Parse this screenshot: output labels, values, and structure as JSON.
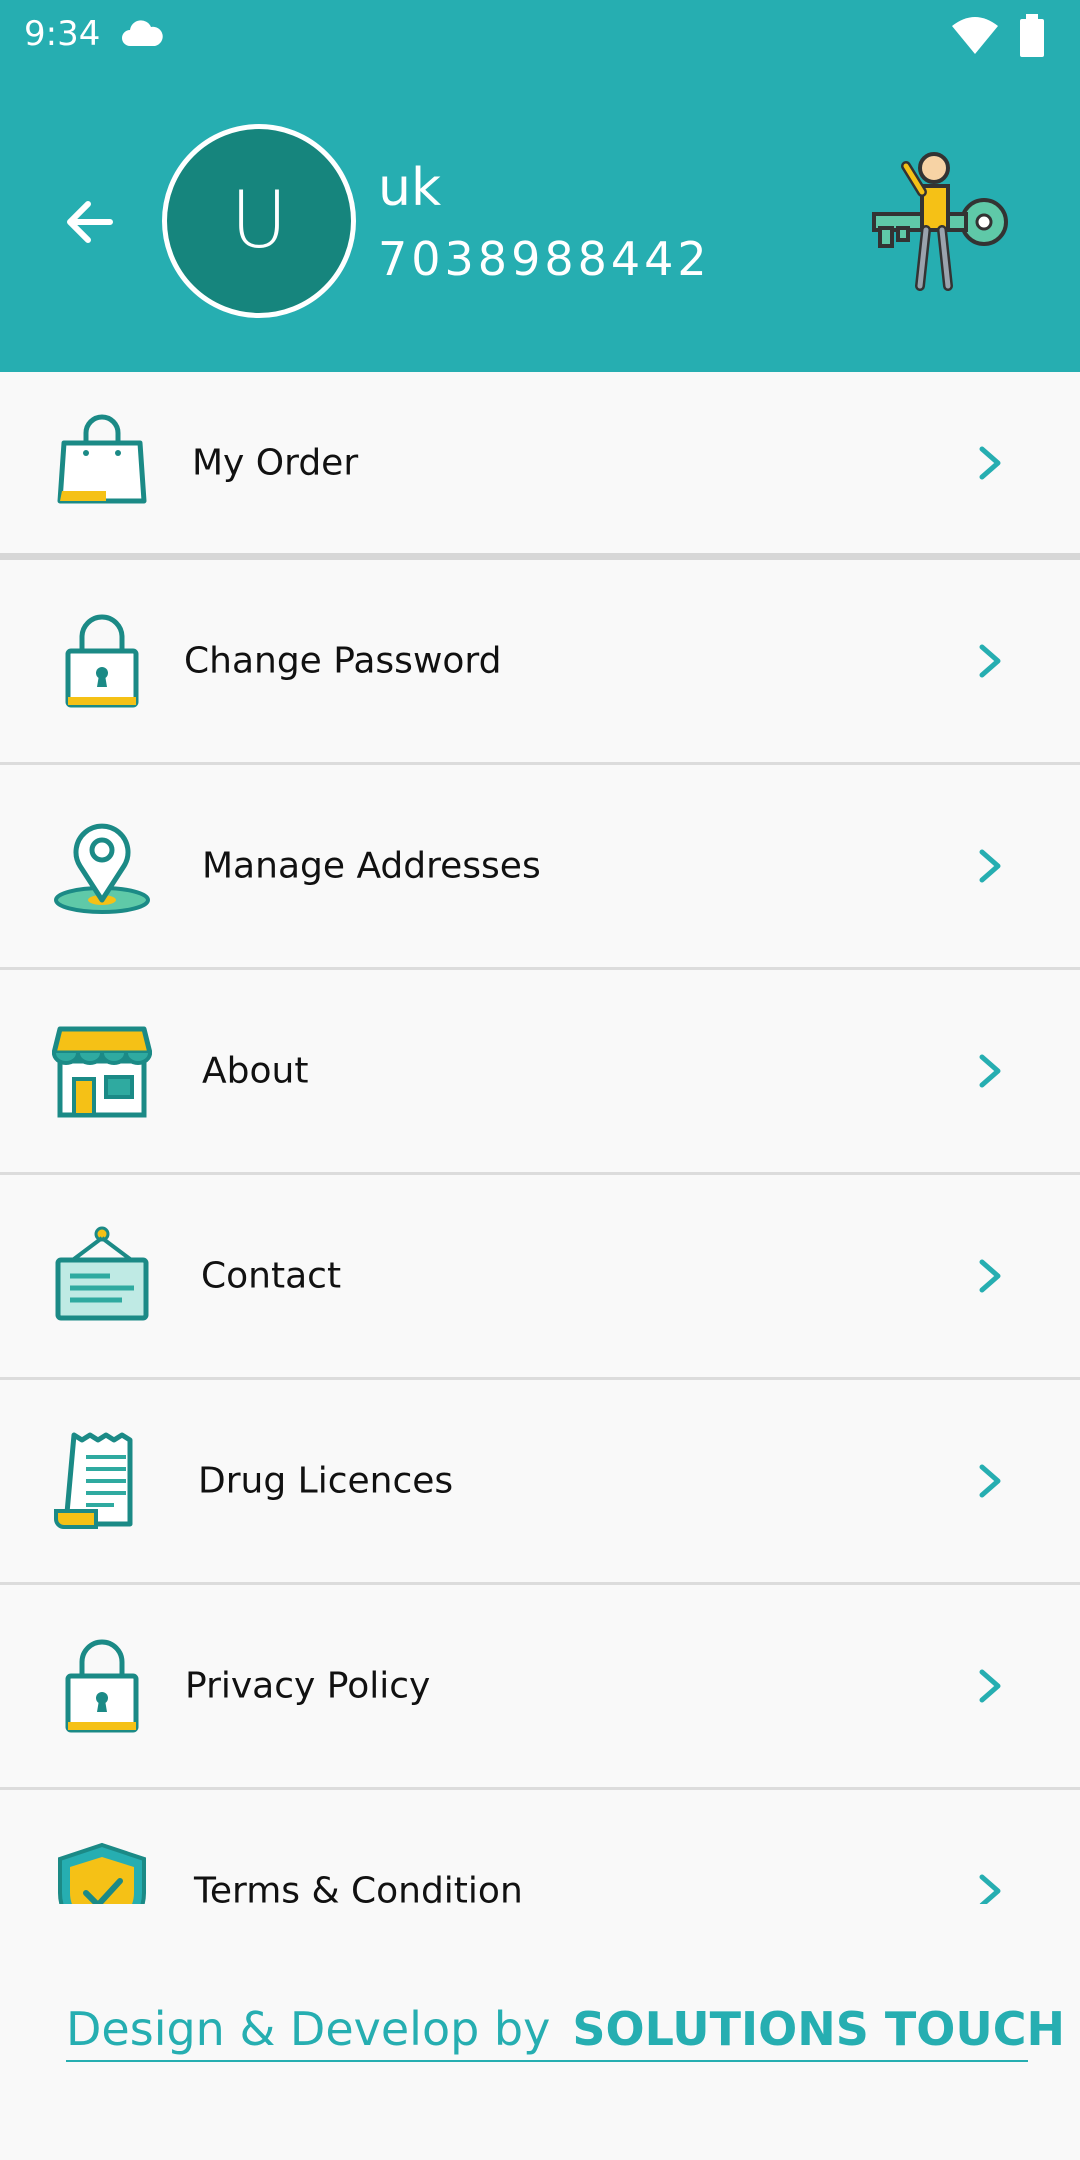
{
  "status_bar": {
    "time": "9:34"
  },
  "profile": {
    "avatar_letter": "U",
    "name": "uk",
    "phone": "7038988442"
  },
  "menu": {
    "items": [
      {
        "label": "My Order",
        "icon": "shopping-bag-icon"
      },
      {
        "label": "Change Password",
        "icon": "padlock-icon"
      },
      {
        "label": "Manage Addresses",
        "icon": "location-pin-icon"
      },
      {
        "label": "About",
        "icon": "storefront-icon"
      },
      {
        "label": "Contact",
        "icon": "hanging-sign-icon"
      },
      {
        "label": "Drug Licences",
        "icon": "document-scroll-icon"
      },
      {
        "label": "Privacy Policy",
        "icon": "padlock-icon"
      },
      {
        "label": "Terms & Condition",
        "icon": "shield-check-icon"
      }
    ]
  },
  "footer": {
    "credit_prefix": "Design & Develop by",
    "credit_brand": "SOLUTIONS TOUCH"
  },
  "colors": {
    "primary": "#26aeb1",
    "avatar": "#16857d",
    "icon_stroke": "#1b8a86",
    "icon_accent": "#f5c116"
  }
}
